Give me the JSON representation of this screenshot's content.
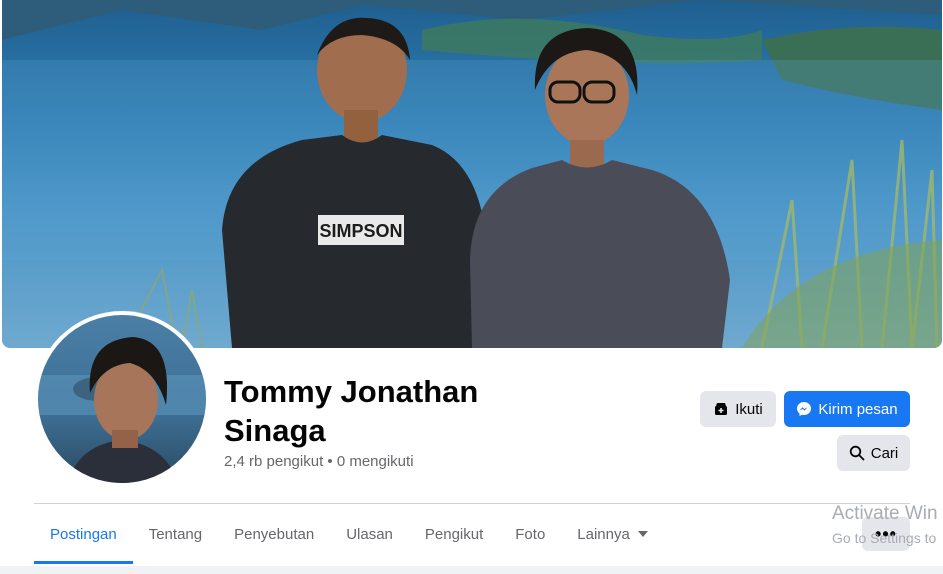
{
  "profile": {
    "name": "Tommy Jonathan Sinaga",
    "stats": "2,4 rb pengikut • 0 mengikuti"
  },
  "actions": {
    "follow_label": "Ikuti",
    "message_label": "Kirim pesan",
    "search_label": "Cari",
    "more_label": "•••"
  },
  "tabs": [
    {
      "label": "Postingan",
      "active": true
    },
    {
      "label": "Tentang"
    },
    {
      "label": "Penyebutan"
    },
    {
      "label": "Ulasan"
    },
    {
      "label": "Pengikut"
    },
    {
      "label": "Foto"
    },
    {
      "label": "Lainnya",
      "dropdown": true
    }
  ],
  "cover": {
    "shirt_text": "SIMPSON"
  },
  "watermark": {
    "line1": "Activate Win",
    "line2": "Go to Settings to"
  },
  "colors": {
    "accent": "#1877f2",
    "secondary_button": "#e4e6eb",
    "muted_text": "#65676b"
  },
  "icons": [
    "follow-icon",
    "messenger-icon",
    "search-icon",
    "more-icon",
    "chevron-down-icon"
  ]
}
